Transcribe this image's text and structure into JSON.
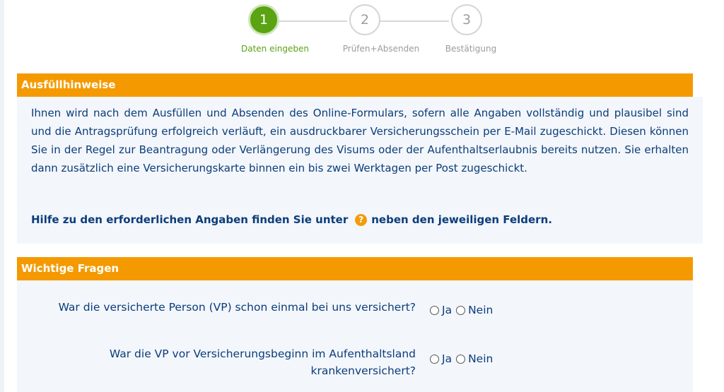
{
  "stepper": {
    "steps": [
      {
        "number": "1",
        "label": "Daten eingeben",
        "active": true
      },
      {
        "number": "2",
        "label": "Prüfen+Absenden",
        "active": false
      },
      {
        "number": "3",
        "label": "Bestätigung",
        "active": false
      }
    ]
  },
  "hints": {
    "title": "Ausfüllhinweise",
    "text": "Ihnen wird nach dem Ausfüllen und Absenden des Online-Formulars, sofern alle Angaben vollständig und plausibel sind und die Antragsprüfung erfolgreich verläuft, ein ausdruckbarer Versicherungsschein per E-Mail zugeschickt. Diesen können Sie in der Regel zur Beantragung oder Verlängerung des Visums oder der Aufenthaltserlaubnis bereits nutzen. Sie erhalten dann zusätzlich eine Versicherungskarte binnen ein bis zwei Werktagen per Post zugeschickt.",
    "help_before": "Hilfe zu den erforderlichen Angaben finden Sie unter",
    "help_icon": "?",
    "help_after": "neben den jeweiligen Feldern."
  },
  "questions": {
    "title": "Wichtige Fragen",
    "items": [
      {
        "line1": "War die versicherte Person (VP) schon einmal bei uns versichert?",
        "line2": ""
      },
      {
        "line1": "War die VP vor Versicherungsbeginn im Aufenthaltsland",
        "line2": "krankenversichert?"
      }
    ],
    "yes_label": "Ja",
    "no_label": "Nein"
  },
  "colors": {
    "accent_orange": "#f49a00",
    "active_green": "#5aa313",
    "text_blue": "#0b3d7a",
    "panel_bg": "#f3f6fb"
  }
}
